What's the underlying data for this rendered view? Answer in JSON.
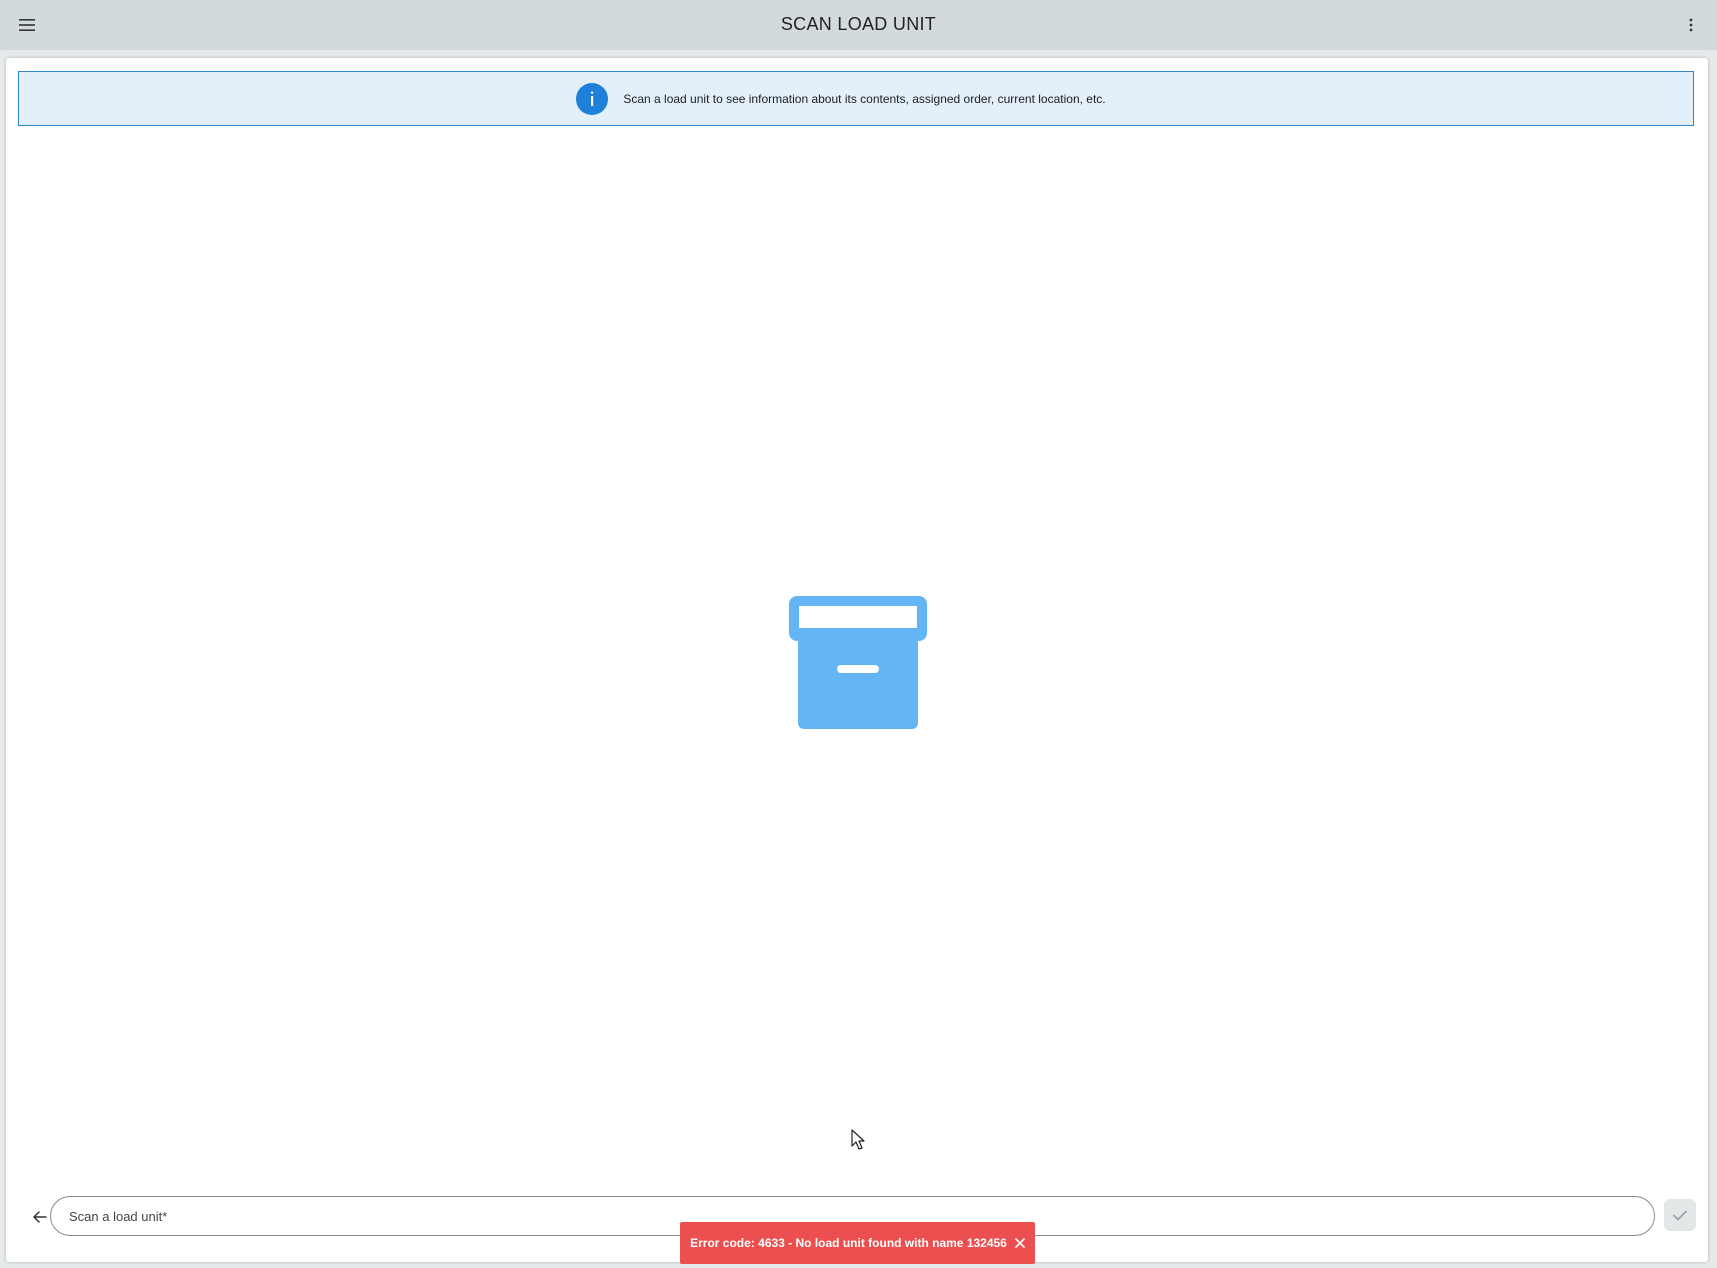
{
  "header": {
    "title": "SCAN LOAD UNIT",
    "menu_icon": "hamburger-menu-icon",
    "more_icon": "more-vertical-icon"
  },
  "info_banner": {
    "icon": "info-icon",
    "text": "Scan a load unit to see information about its contents, assigned order, current location, etc."
  },
  "illustration": {
    "icon": "archive-box-icon",
    "color": "#64b5f6"
  },
  "input_bar": {
    "back_icon": "arrow-left-icon",
    "placeholder": "Scan a load unit*",
    "value": "",
    "confirm_icon": "check-icon"
  },
  "toast": {
    "message": "Error code: 4633 - No load unit found with name 132456",
    "close_icon": "close-icon",
    "color": "#ec4f4f"
  },
  "colors": {
    "accent": "#1e80d8",
    "banner_bg": "#e3f0fa",
    "topbar_bg": "#d3dadb"
  }
}
